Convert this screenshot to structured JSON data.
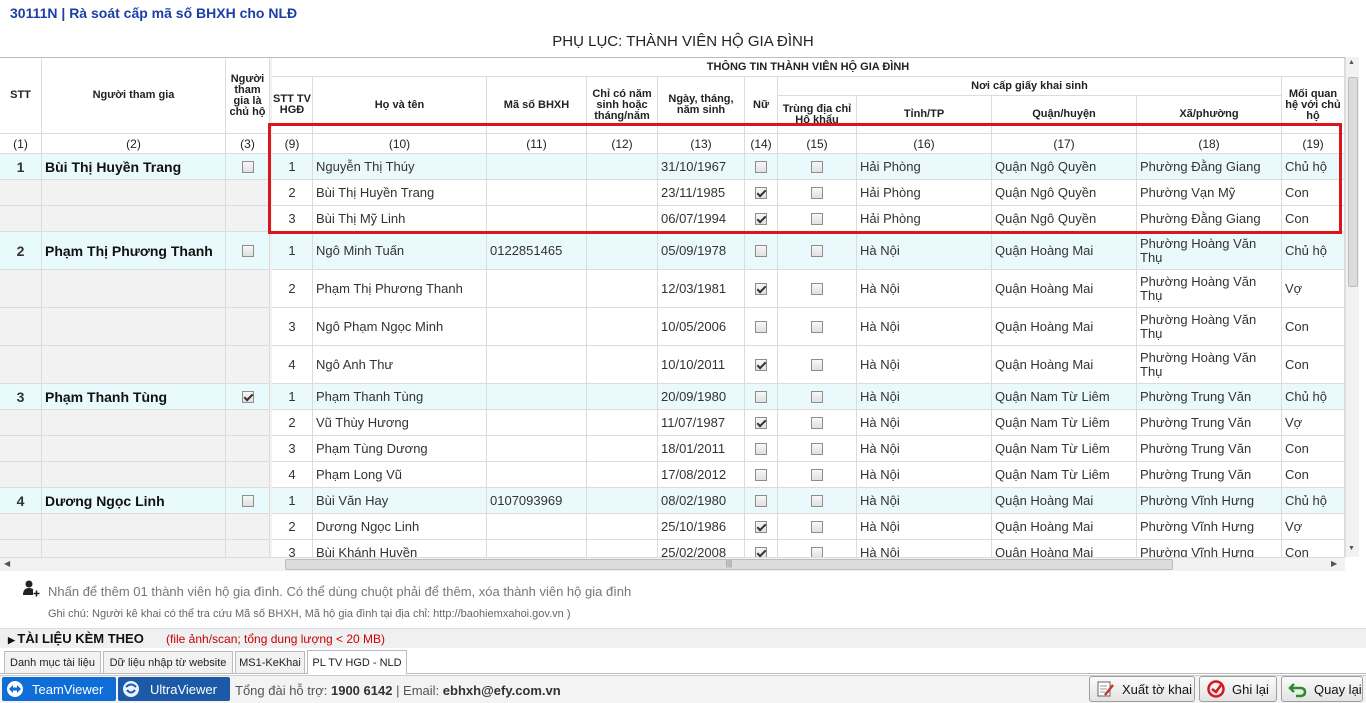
{
  "app_title": "30111N | Rà soát cấp mã số BHXH cho NLĐ",
  "page_title": "PHỤ LỤC: THÀNH VIÊN HỘ GIA ĐÌNH",
  "headers": {
    "stt": "STT",
    "participant": "Người tham gia",
    "is_head": "Người tham gia là chủ hộ",
    "group_title": "THÔNG TIN THÀNH VIÊN HỘ GIA ĐÌNH",
    "member_stt": "STT TV HGĐ",
    "full_name": "Họ và tên",
    "bhxh_code": "Mã số BHXH",
    "year_only": "Chỉ có năm sinh hoặc tháng/năm",
    "dob": "Ngày, tháng, năm sinh",
    "female": "Nữ",
    "birthcert_group": "Nơi cấp giấy khai sinh",
    "same_household": "Trùng địa chỉ Hộ khẩu",
    "province": "Tỉnh/TP",
    "district": "Quận/huyện",
    "ward": "Xã/phường",
    "relation": "Mối quan hệ với chủ hộ"
  },
  "col_numbers": [
    "(1)",
    "(2)",
    "(3)",
    "(9)",
    "(10)",
    "(11)",
    "(12)",
    "(13)",
    "(14)",
    "(15)",
    "(16)",
    "(17)",
    "(18)",
    "(19)"
  ],
  "groups": [
    {
      "stt": "1",
      "name": "Bùi Thị Huyền Trang",
      "is_head": false,
      "members": [
        {
          "stt": "1",
          "name": "Nguyễn Thị Thúy",
          "bhxh": "",
          "dob": "31/10/1967",
          "female": false,
          "same": false,
          "province": "Hải Phòng",
          "district": "Quận Ngô Quyền",
          "ward": "Phường Đằng Giang",
          "relation": "Chủ hộ"
        },
        {
          "stt": "2",
          "name": "Bùi Thị Huyền Trang",
          "bhxh": "",
          "dob": "23/11/1985",
          "female": true,
          "same": false,
          "province": "Hải Phòng",
          "district": "Quận Ngô Quyền",
          "ward": "Phường Vạn Mỹ",
          "relation": "Con"
        },
        {
          "stt": "3",
          "name": "Bùi Thị Mỹ Linh",
          "bhxh": "",
          "dob": "06/07/1994",
          "female": true,
          "same": false,
          "province": "Hải Phòng",
          "district": "Quận Ngô Quyền",
          "ward": "Phường Đằng Giang",
          "relation": "Con"
        }
      ]
    },
    {
      "stt": "2",
      "name": "Phạm Thị Phương Thanh",
      "is_head": false,
      "members": [
        {
          "stt": "1",
          "name": "Ngô Minh Tuấn",
          "bhxh": "0122851465",
          "dob": "05/09/1978",
          "female": false,
          "same": false,
          "province": "Hà Nội",
          "district": "Quận Hoàng Mai",
          "ward": "Phường Hoàng Văn Thụ",
          "relation": "Chủ hộ"
        },
        {
          "stt": "2",
          "name": "Phạm Thị Phương Thanh",
          "bhxh": "",
          "dob": "12/03/1981",
          "female": true,
          "same": false,
          "province": "Hà Nội",
          "district": "Quận Hoàng Mai",
          "ward": "Phường Hoàng Văn Thụ",
          "relation": "Vợ"
        },
        {
          "stt": "3",
          "name": "Ngô Phạm Ngọc Minh",
          "bhxh": "",
          "dob": "10/05/2006",
          "female": false,
          "same": false,
          "province": "Hà Nội",
          "district": "Quận Hoàng Mai",
          "ward": "Phường Hoàng Văn Thụ",
          "relation": "Con"
        },
        {
          "stt": "4",
          "name": "Ngô Anh Thư",
          "bhxh": "",
          "dob": "10/10/2011",
          "female": true,
          "same": false,
          "province": "Hà Nội",
          "district": "Quận Hoàng Mai",
          "ward": "Phường Hoàng Văn Thụ",
          "relation": "Con"
        }
      ]
    },
    {
      "stt": "3",
      "name": "Phạm Thanh Tùng",
      "is_head": true,
      "members": [
        {
          "stt": "1",
          "name": "Phạm Thanh Tùng",
          "bhxh": "",
          "dob": "20/09/1980",
          "female": false,
          "same": false,
          "province": "Hà Nội",
          "district": "Quận Nam Từ Liêm",
          "ward": "Phường Trung Văn",
          "relation": "Chủ hộ"
        },
        {
          "stt": "2",
          "name": "Vũ Thùy Hương",
          "bhxh": "",
          "dob": "11/07/1987",
          "female": true,
          "same": false,
          "province": "Hà Nội",
          "district": "Quận Nam Từ Liêm",
          "ward": "Phường Trung Văn",
          "relation": "Vợ"
        },
        {
          "stt": "3",
          "name": "Phạm Tùng Dương",
          "bhxh": "",
          "dob": "18/01/2011",
          "female": false,
          "same": false,
          "province": "Hà Nội",
          "district": "Quận Nam Từ Liêm",
          "ward": "Phường Trung Văn",
          "relation": "Con"
        },
        {
          "stt": "4",
          "name": "Phạm Long Vũ",
          "bhxh": "",
          "dob": "17/08/2012",
          "female": false,
          "same": false,
          "province": "Hà Nội",
          "district": "Quận Nam Từ Liêm",
          "ward": "Phường Trung Văn",
          "relation": "Con"
        }
      ]
    },
    {
      "stt": "4",
      "name": "Dương Ngọc Linh",
      "is_head": false,
      "members": [
        {
          "stt": "1",
          "name": "Bùi Văn Hay",
          "bhxh": "0107093969",
          "dob": "08/02/1980",
          "female": false,
          "same": false,
          "province": "Hà Nội",
          "district": "Quận Hoàng Mai",
          "ward": "Phường Vĩnh Hưng",
          "relation": "Chủ hộ"
        },
        {
          "stt": "2",
          "name": "Dương Ngọc Linh",
          "bhxh": "",
          "dob": "25/10/1986",
          "female": true,
          "same": false,
          "province": "Hà Nội",
          "district": "Quận Hoàng Mai",
          "ward": "Phường Vĩnh Hưng",
          "relation": "Vợ"
        },
        {
          "stt": "3",
          "name": "Bùi Khánh Huyền",
          "bhxh": "",
          "dob": "25/02/2008",
          "female": true,
          "same": false,
          "province": "Hà Nội",
          "district": "Quận Hoàng Mai",
          "ward": "Phường Vĩnh Hưng",
          "relation": "Con"
        }
      ]
    }
  ],
  "hint": "Nhấn để thêm 01 thành viên hộ gia đình. Có thể dùng chuột phải để thêm, xóa thành viên hộ gia đình",
  "note": "Ghi chú: Người kê khai có thể tra cứu Mã số BHXH, Mã hộ gia đình tại địa chỉ: http://baohiemxahoi.gov.vn )",
  "attach_title": "TÀI LIỆU KÈM THEO",
  "attach_note": "(file ảnh/scan; tổng dung lượng < 20 MB)",
  "tabs": [
    "Danh mục tài liệu",
    "Dữ liệu nhập từ website",
    "MS1-KeKhai",
    "PL TV HGD - NLD"
  ],
  "active_tab": "PL TV HGD - NLD",
  "teamviewer": "TeamViewer",
  "ultraviewer": "UltraViewer",
  "support_label": "Tổng đài hỗ trợ:",
  "support_phone": "1900 6142",
  "email_label": "| Email:",
  "email": "ebhxh@efy.com.vn",
  "buttons": {
    "export": "Xuất tờ khai",
    "save": "Ghi lại",
    "back": "Quay lại"
  },
  "colors": {
    "highlight": "#d8161b",
    "group_row": "#eaf9fb",
    "title": "#1b3fa8"
  }
}
